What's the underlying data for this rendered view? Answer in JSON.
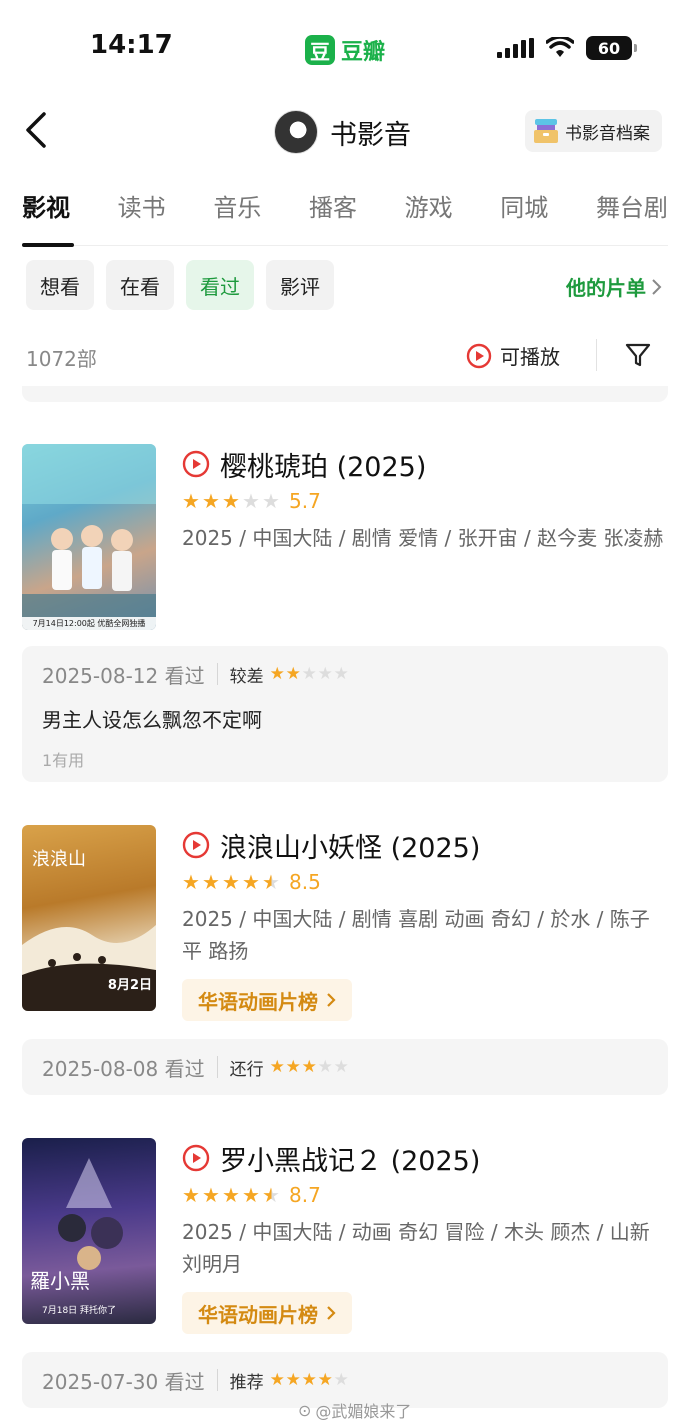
{
  "status_bar": {
    "time": "14:17",
    "app_logo": "豆",
    "app_name": "豆瓣",
    "battery": "60"
  },
  "header": {
    "title": "书影音",
    "archive_label": "书影音档案"
  },
  "tabs": [
    {
      "label": "影视",
      "active": true
    },
    {
      "label": "读书"
    },
    {
      "label": "音乐"
    },
    {
      "label": "播客"
    },
    {
      "label": "游戏"
    },
    {
      "label": "同城"
    },
    {
      "label": "舞台剧"
    }
  ],
  "filters": {
    "chips": [
      {
        "label": "想看"
      },
      {
        "label": "在看"
      },
      {
        "label": "看过",
        "active": true
      },
      {
        "label": "影评"
      }
    ],
    "his_list": "他的片单"
  },
  "list_meta": {
    "count": "1072部",
    "playable_label": "可播放"
  },
  "movies": [
    {
      "title": "樱桃琥珀 (2025)",
      "rating_stars": 3,
      "score": "5.7",
      "meta": "2025 / 中国大陆 / 剧情 爱情 / 张开宙 / 赵今麦 张凌赫",
      "poster_text": "7月14日12:00起 优酷全网独播",
      "review": {
        "date": "2025-08-12 看过",
        "verdict": "较差",
        "stars": 2,
        "text": "男主人设怎么飘忽不定啊",
        "useful": "1有用"
      }
    },
    {
      "title": "浪浪山小妖怪 (2025)",
      "rating_stars": 4.5,
      "score": "8.5",
      "meta": "2025 / 中国大陆 / 剧情 喜剧 动画 奇幻 / 於水 / 陈子平 路扬",
      "chart": "华语动画片榜",
      "poster_text": "8月2日",
      "review": {
        "date": "2025-08-08 看过",
        "verdict": "还行",
        "stars": 3
      }
    },
    {
      "title": "罗小黑战记２ (2025)",
      "rating_stars": 4.5,
      "score": "8.7",
      "meta": "2025 / 中国大陆 / 动画 奇幻 冒险 / 木头 顾杰 / 山新 刘明月",
      "chart": "华语动画片榜",
      "poster_text": "7月18日 拜托你了",
      "review": {
        "date": "2025-07-30 看过",
        "verdict": "推荐",
        "stars": 4
      }
    }
  ],
  "watermark": "@武媚娘来了",
  "colors": {
    "accent_green": "#1e9a3e",
    "star_orange": "#f5a623",
    "play_red": "#e53935",
    "chart_orange": "#d48a12"
  }
}
